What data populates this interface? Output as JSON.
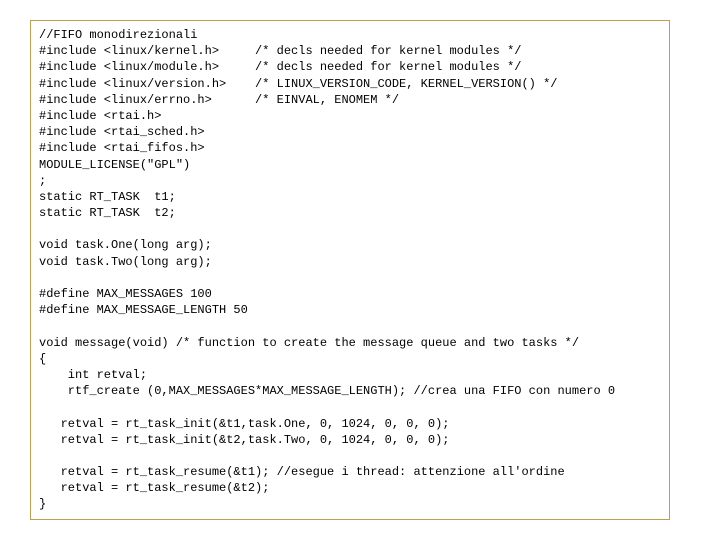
{
  "code": {
    "l01": "//FIFO monodirezionali",
    "l02": "#include <linux/kernel.h>     /* decls needed for kernel modules */",
    "l03": "#include <linux/module.h>     /* decls needed for kernel modules */",
    "l04": "#include <linux/version.h>    /* LINUX_VERSION_CODE, KERNEL_VERSION() */",
    "l05": "#include <linux/errno.h>      /* EINVAL, ENOMEM */",
    "l06": "#include <rtai.h>",
    "l07": "#include <rtai_sched.h>",
    "l08": "#include <rtai_fifos.h>",
    "l09": "MODULE_LICENSE(\"GPL\")",
    "l10": ";",
    "l11": "static RT_TASK  t1;",
    "l12": "static RT_TASK  t2;",
    "l13": "",
    "l14": "void task.One(long arg);",
    "l15": "void task.Two(long arg);",
    "l16": "",
    "l17": "#define MAX_MESSAGES 100",
    "l18": "#define MAX_MESSAGE_LENGTH 50",
    "l19": "",
    "l20": "void message(void) /* function to create the message queue and two tasks */",
    "l21": "{",
    "l22": "    int retval;",
    "l23": "    rtf_create (0,MAX_MESSAGES*MAX_MESSAGE_LENGTH); //crea una FIFO con numero 0",
    "l24": "",
    "l25": "   retval = rt_task_init(&t1,task.One, 0, 1024, 0, 0, 0);",
    "l26": "   retval = rt_task_init(&t2,task.Two, 0, 1024, 0, 0, 0);",
    "l27": "",
    "l28": "   retval = rt_task_resume(&t1); //esegue i thread: attenzione all'ordine",
    "l29": "   retval = rt_task_resume(&t2);",
    "l30": "}"
  }
}
